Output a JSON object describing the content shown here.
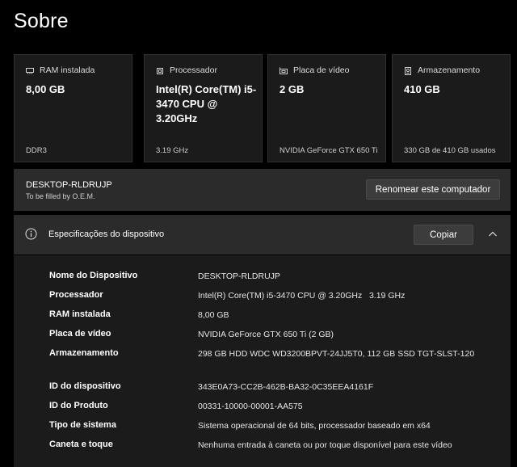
{
  "page": {
    "title": "Sobre"
  },
  "cards": [
    {
      "icon": "ram-icon",
      "title": "RAM instalada",
      "value": "8,00 GB",
      "sub": "DDR3"
    },
    {
      "icon": "processor-icon",
      "title": "Processador",
      "value": "Intel(R) Core(TM) i5-3470 CPU @ 3.20GHz",
      "sub": "3.19 GHz"
    },
    {
      "icon": "graphics-card-icon",
      "title": "Placa de vídeo",
      "value": "2 GB",
      "sub": "NVIDIA GeForce GTX 650 Ti"
    },
    {
      "icon": "storage-icon",
      "title": "Armazenamento",
      "value": "410 GB",
      "sub": "330 GB de 410 GB usados"
    }
  ],
  "device": {
    "name": "DESKTOP-RLDRUJP",
    "oem": "To be filled by O.E.M.",
    "rename_label": "Renomear este computador"
  },
  "specs": {
    "title": "Especificações do dispositivo",
    "copy_label": "Copiar",
    "rows": [
      {
        "label": "Nome do Dispositivo",
        "value": "DESKTOP-RLDRUJP"
      },
      {
        "label": "Processador",
        "value": "Intel(R) Core(TM) i5-3470 CPU @ 3.20GHz   3.19 GHz"
      },
      {
        "label": "RAM instalada",
        "value": "8,00 GB"
      },
      {
        "label": "Placa de vídeo",
        "value": "NVIDIA GeForce GTX 650 Ti (2 GB)"
      },
      {
        "label": "Armazenamento",
        "value": "298 GB HDD WDC WD3200BPVT-24JJ5T0, 112 GB SSD TGT-SLST-120"
      },
      {
        "label": "ID do dispositivo",
        "value": "343E0A73-CC2B-462B-BA32-0C35EEA4161F"
      },
      {
        "label": "ID do Produto",
        "value": "00331-10000-00001-AA575"
      },
      {
        "label": "Tipo de sistema",
        "value": "Sistema operacional de 64 bits, processador baseado em x64"
      },
      {
        "label": "Caneta e toque",
        "value": "Nenhuma entrada à caneta ou por toque disponível para este vídeo"
      }
    ]
  },
  "colors": {
    "background": "#000000",
    "card": "#1b1b1b",
    "panel": "#2b2b2b",
    "button": "#3c3c3c"
  }
}
